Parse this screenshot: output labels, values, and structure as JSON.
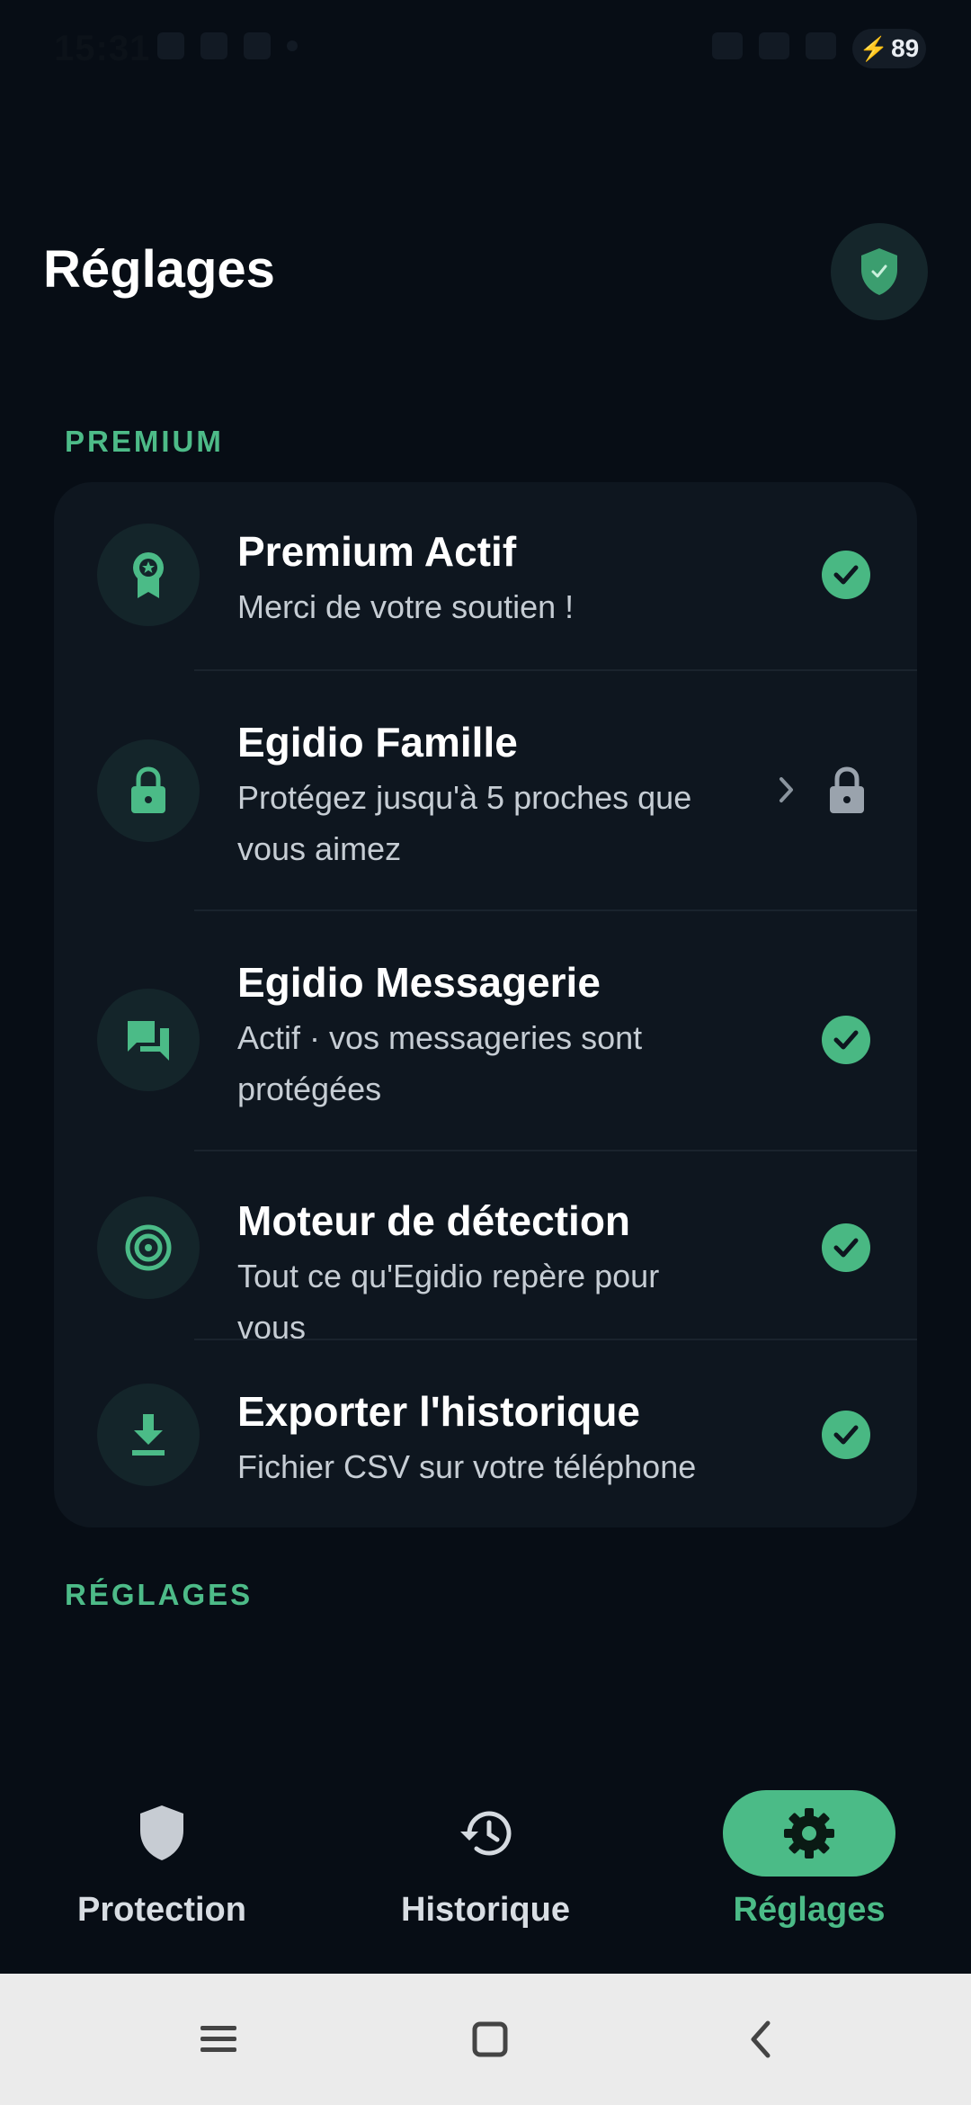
{
  "status_bar": {
    "time": "15:31",
    "battery": "89"
  },
  "header": {
    "title": "Réglages",
    "shield_icon": "shield-check-icon"
  },
  "sections": {
    "premium_label": "PREMIUM",
    "settings_label": "RÉGLAGES"
  },
  "premium_items": [
    {
      "title": "Premium Actif",
      "subtitle": "Merci de votre soutien !",
      "icon": "award-icon",
      "status": "check"
    },
    {
      "title": "Egidio Famille",
      "subtitle": "Protégez jusqu'à 5 proches que vous aimez",
      "icon": "lock-icon",
      "status": "locked"
    },
    {
      "title": "Egidio Messagerie",
      "subtitle": "Actif · vos messageries sont protégées",
      "icon": "chat-icon",
      "status": "check"
    },
    {
      "title": "Moteur de détection",
      "subtitle": "Tout ce qu'Egidio repère pour vous",
      "icon": "target-icon",
      "status": "check"
    },
    {
      "title": "Exporter l'historique",
      "subtitle": "Fichier CSV sur votre téléphone",
      "icon": "download-icon",
      "status": "check"
    }
  ],
  "nav": [
    {
      "label": "Protection",
      "icon": "shield-icon",
      "active": false
    },
    {
      "label": "Historique",
      "icon": "history-icon",
      "active": false
    },
    {
      "label": "Réglages",
      "icon": "gear-icon",
      "active": true
    }
  ],
  "colors": {
    "accent": "#4bbb87",
    "background": "#070d15",
    "card": "#0e161f"
  }
}
